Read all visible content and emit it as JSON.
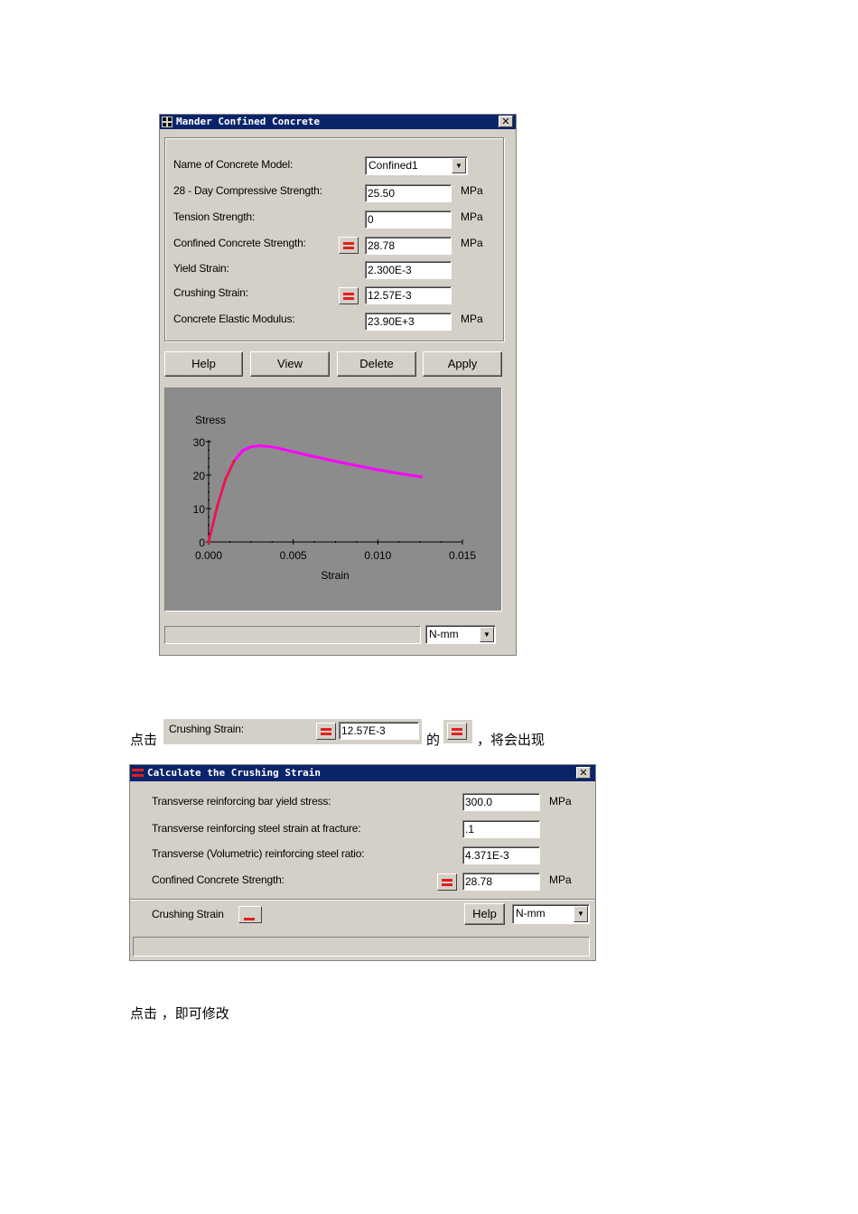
{
  "dialog1": {
    "title": "Mander Confined Concrete",
    "close": "✕",
    "fields": {
      "model_name_label": "Name of Concrete Model:",
      "model_name_value": "Confined1",
      "fc28_label": "28 - Day Compressive Strength:",
      "fc28_value": "25.50",
      "fc28_unit": "MPa",
      "tension_label": "Tension Strength:",
      "tension_value": "0",
      "tension_unit": "MPa",
      "confined_label": "Confined Concrete Strength:",
      "confined_value": "28.78",
      "confined_unit": "MPa",
      "yield_label": "Yield Strain:",
      "yield_value": "2.300E-3",
      "crushing_label": "Crushing Strain:",
      "crushing_value": "12.57E-3",
      "modulus_label": "Concrete Elastic Modulus:",
      "modulus_value": "23.90E+3",
      "modulus_unit": "MPa"
    },
    "buttons": {
      "help": "Help",
      "view": "View",
      "delete": "Delete",
      "apply": "Apply"
    },
    "units_select": "N-mm",
    "status_text": ""
  },
  "chart_data": {
    "type": "line",
    "title": "",
    "xlabel": "Strain",
    "ylabel": "Stress",
    "xlim": [
      0,
      0.015
    ],
    "ylim": [
      0,
      30
    ],
    "x_ticks": [
      "0.000",
      "0.005",
      "0.010",
      "0.015"
    ],
    "y_ticks": [
      "0",
      "10",
      "20",
      "30"
    ],
    "grid": false,
    "series": [
      {
        "color": "#ff00ff",
        "x": [
          0,
          0.0005,
          0.001,
          0.0015,
          0.002,
          0.0025,
          0.003,
          0.0035,
          0.004,
          0.005,
          0.006,
          0.007,
          0.008,
          0.009,
          0.01,
          0.011,
          0.012,
          0.01257
        ],
        "y": [
          0,
          10.5,
          18.8,
          24.2,
          27.3,
          28.5,
          28.78,
          28.6,
          28.2,
          27.0,
          25.8,
          24.7,
          23.6,
          22.6,
          21.6,
          20.7,
          19.9,
          19.5
        ]
      },
      {
        "color": "#e0201e",
        "x": [
          0,
          0.0005,
          0.001,
          0.0015
        ],
        "y": [
          0,
          10.5,
          18.8,
          24.2
        ]
      }
    ]
  },
  "inline_sentence": {
    "prefix": "点击",
    "snippet_label": "Crushing Strain:",
    "snippet_value": "12.57E-3",
    "middle": "的",
    "suffix": "，将会出现"
  },
  "dialog2": {
    "title": "Calculate the Crushing Strain",
    "close": "✕",
    "rows": [
      {
        "label": "Transverse reinforcing bar yield stress:",
        "value": "300.0",
        "unit": "MPa"
      },
      {
        "label": "Transverse reinforcing steel strain at fracture:",
        "value": ".1",
        "unit": ""
      },
      {
        "label": "Transverse (Volumetric) reinforcing steel ratio:",
        "value": "4.371E-3",
        "unit": ""
      },
      {
        "label": "Confined Concrete Strength:",
        "value": "28.78",
        "unit": "MPa"
      }
    ],
    "crushing_label": "Crushing Strain",
    "help": "Help",
    "units_select": "N-mm"
  },
  "bottom_sentence": "点击 ，即可修改"
}
